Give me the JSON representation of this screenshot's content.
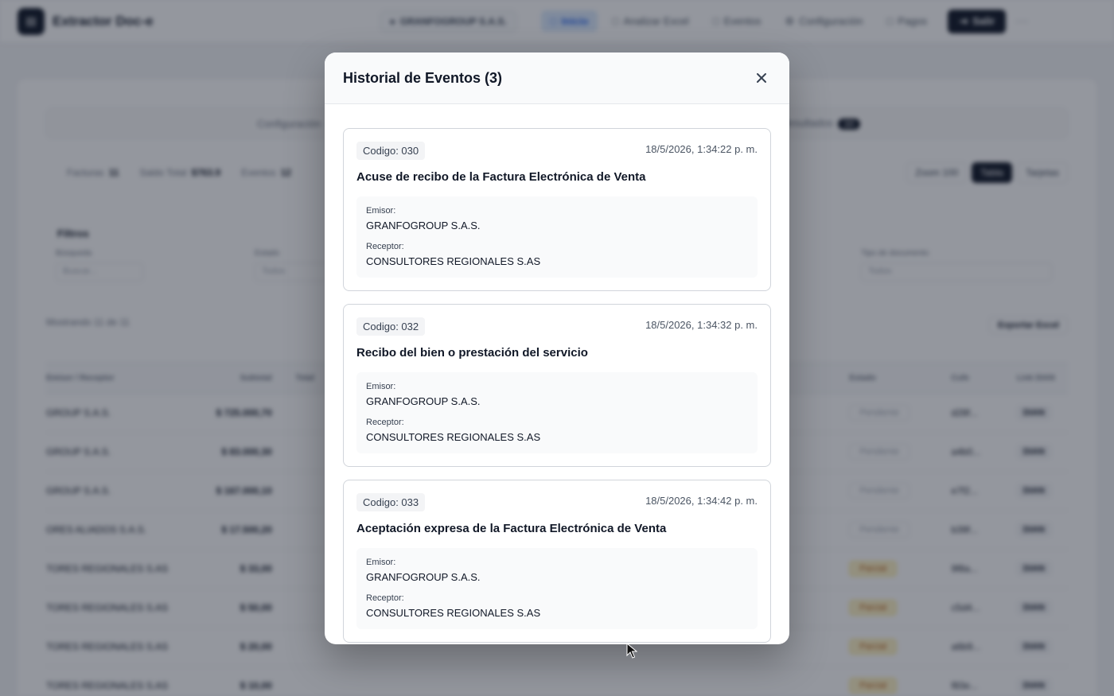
{
  "app": {
    "brand": "Extractor Doc-e",
    "company": "GRANFOGROUP S.A.S.",
    "nav": [
      "Inicio",
      "Analizar Excel",
      "Eventos",
      "Configuración",
      "Pagos"
    ],
    "logout": "Salir",
    "tabs": {
      "left": "Configuración",
      "right": "Resultados",
      "right_count": "10"
    },
    "stats": [
      {
        "label": "Facturas",
        "value": "11"
      },
      {
        "label": "Saldo Total",
        "value": "$763.9"
      },
      {
        "label": "Eventos",
        "value": "12"
      }
    ],
    "view": {
      "zoom": "Zoom 100",
      "table": "Tabla",
      "cards": "Tarjetas"
    },
    "filters": {
      "title": "Filtros",
      "search_label": "Búsqueda",
      "search_placeholder": "Buscar...",
      "status_label": "Estado",
      "status_value": "Todos",
      "doctype_label": "Tipo de documento",
      "doctype_value": "Todos"
    },
    "results": {
      "text": "Mostrando 11 de 11",
      "export": "Exportar Excel"
    },
    "table": {
      "headers": [
        "Emisor / Receptor",
        "Subtotal",
        "Total",
        "Estado",
        "Cufe",
        "Link DIAN"
      ],
      "rows": [
        {
          "party": "GROUP S.A.S.",
          "amount": "$ 725.000,70",
          "status": "Pendiente",
          "warn": false,
          "cufe": "d28f..."
        },
        {
          "party": "GROUP S.A.S.",
          "amount": "$ 83.000,30",
          "status": "Pendiente",
          "warn": false,
          "cufe": "a4b0..."
        },
        {
          "party": "GROUP S.A.S.",
          "amount": "$ 167.000,10",
          "status": "Pendiente",
          "warn": false,
          "cufe": "e7f2..."
        },
        {
          "party": "ORES ALIADOS S.A.S.",
          "amount": "$ 17.500,20",
          "status": "Pendiente",
          "warn": false,
          "cufe": "b39f..."
        },
        {
          "party": "TORES REGIONALES S.AS",
          "amount": "$ 33,00",
          "status": "Parcial",
          "warn": true,
          "cufe": "9f8a..."
        },
        {
          "party": "TORES REGIONALES S.AS",
          "amount": "$ 50,00",
          "status": "Parcial",
          "warn": true,
          "cufe": "c5d4..."
        },
        {
          "party": "TORES REGIONALES S.AS",
          "amount": "$ 20,00",
          "status": "Parcial",
          "warn": true,
          "cufe": "a6b9..."
        },
        {
          "party": "TORES REGIONALES S.AS",
          "amount": "$ 10,00",
          "status": "Parcial",
          "warn": true,
          "cufe": "f83e..."
        }
      ],
      "link_label": "DIAN"
    }
  },
  "modal": {
    "title": "Historial de Eventos (3)",
    "emisor_label": "Emisor:",
    "receptor_label": "Receptor:",
    "events": [
      {
        "code": "Codigo: 030",
        "date": "18/5/2026, 1:34:22 p. m.",
        "description": "Acuse de recibo de la Factura Electrónica de Venta",
        "emisor": "GRANFOGROUP S.A.S.",
        "receptor": "CONSULTORES REGIONALES S.AS"
      },
      {
        "code": "Codigo: 032",
        "date": "18/5/2026, 1:34:32 p. m.",
        "description": "Recibo del bien o prestación del servicio",
        "emisor": "GRANFOGROUP S.A.S.",
        "receptor": "CONSULTORES REGIONALES S.AS"
      },
      {
        "code": "Codigo: 033",
        "date": "18/5/2026, 1:34:42 p. m.",
        "description": "Aceptación expresa de la Factura Electrónica de Venta",
        "emisor": "GRANFOGROUP S.A.S.",
        "receptor": "CONSULTORES REGIONALES S.AS"
      }
    ]
  },
  "colors": {
    "overlay": "#111827",
    "accent": "#2563eb",
    "warn": "#fef3c7"
  }
}
